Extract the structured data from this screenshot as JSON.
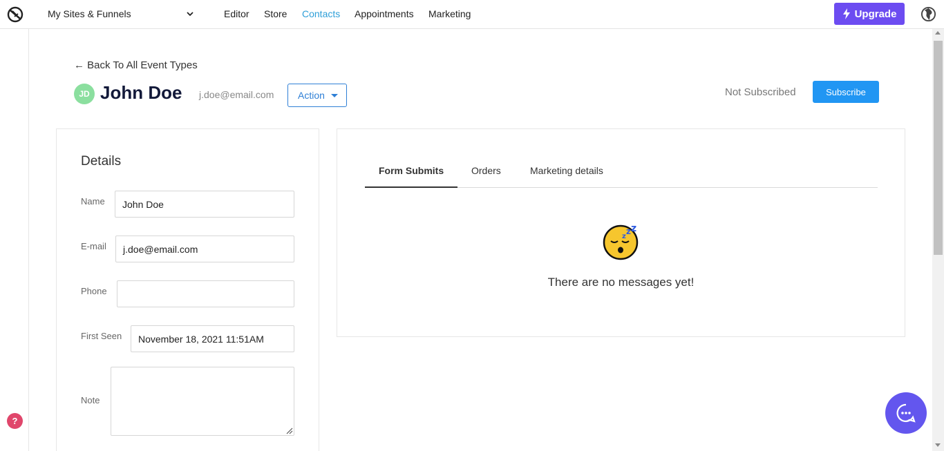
{
  "nav": {
    "site_select": "My Sites & Funnels",
    "links": [
      "Editor",
      "Store",
      "Contacts",
      "Appointments",
      "Marketing"
    ],
    "upgrade_label": "Upgrade"
  },
  "header": {
    "back_label": "← Back To All Event Types",
    "avatar_initials": "JD",
    "name": "John Doe",
    "email": "j.doe@email.com",
    "action_label": "Action",
    "subscription_status": "Not Subscribed",
    "subscribe_label": "Subscribe"
  },
  "details": {
    "title": "Details",
    "fields": [
      {
        "label": "Name",
        "value": "John Doe"
      },
      {
        "label": "E-mail",
        "value": "j.doe@email.com"
      },
      {
        "label": "Phone",
        "value": ""
      },
      {
        "label": "First Seen",
        "value": "November 18, 2021 11:51AM"
      },
      {
        "label": "Note",
        "value": ""
      }
    ]
  },
  "activity": {
    "tabs": [
      "Form Submits",
      "Orders",
      "Marketing details"
    ],
    "active_tab": "Form Submits",
    "empty_message": "There are no messages yet!"
  },
  "help_label": "?",
  "colors": {
    "accent_purple": "#6c4cf1",
    "link_blue": "#2e9fd8",
    "subscribe_blue": "#2196f3",
    "chat_purple": "#6356ee",
    "avatar_green": "#8bdf9f",
    "help_pink": "#e0466b"
  }
}
